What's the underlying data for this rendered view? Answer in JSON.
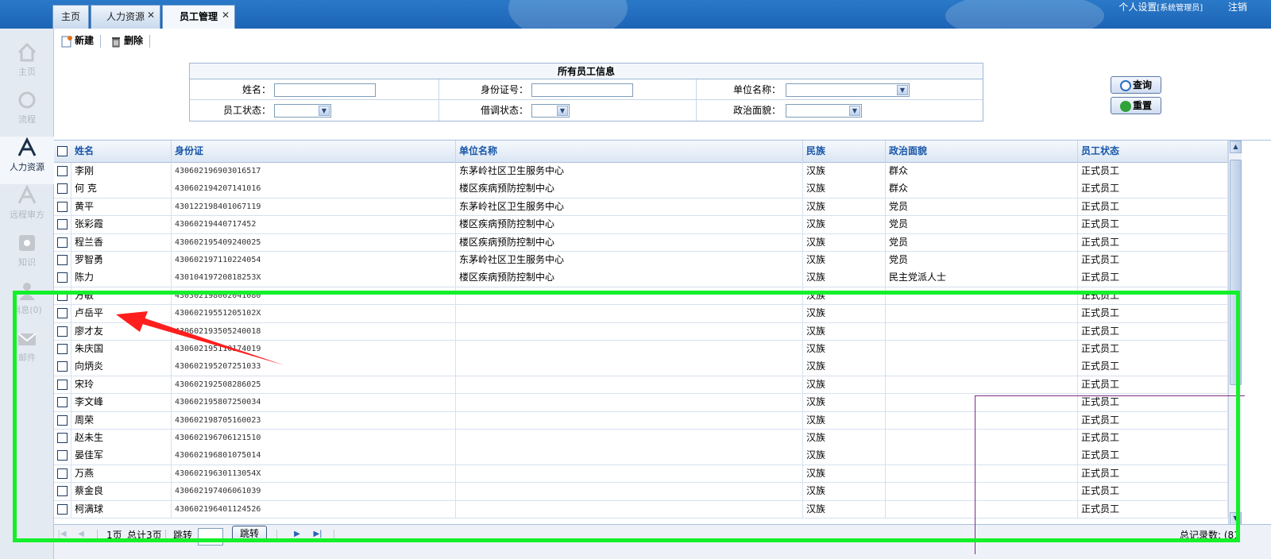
{
  "tabs": [
    {
      "label": "主页",
      "active": false,
      "closable": false
    },
    {
      "label": "人力资源",
      "active": false,
      "closable": true
    },
    {
      "label": "员工管理",
      "active": true,
      "closable": true
    }
  ],
  "topright": {
    "settings": "个人设置",
    "role": "[系统管理员]",
    "logout": "注销"
  },
  "sidebar": [
    {
      "label": "主页",
      "icon": "home-icon",
      "active": false
    },
    {
      "label": "流程",
      "icon": "refresh-icon",
      "active": false
    },
    {
      "label": "人力资源",
      "icon": "hr-icon",
      "active": true
    },
    {
      "label": "远程审方",
      "icon": "review-icon",
      "active": false
    },
    {
      "label": "知识",
      "icon": "knowledge-icon",
      "active": false
    },
    {
      "label": "消息(0)",
      "icon": "message-icon",
      "active": false
    },
    {
      "label": "邮件",
      "icon": "mail-icon",
      "active": false
    }
  ],
  "toolbar": {
    "new_label": "新建",
    "delete_label": "删除"
  },
  "search": {
    "title": "所有员工信息",
    "name_label": "姓名：",
    "id_label": "身份证号：",
    "unit_label": "单位名称：",
    "status_label": "员工状态：",
    "loan_label": "借调状态：",
    "politics_label": "政治面貌：",
    "query_label": "查询",
    "reset_label": "重置"
  },
  "table": {
    "headers": [
      "姓名",
      "身份证",
      "单位名称",
      "民族",
      "政治面貌",
      "员工状态"
    ],
    "rows": [
      [
        "李刚",
        "430602196903016517",
        "东茅岭社区卫生服务中心",
        "汉族",
        "群众",
        "正式员工"
      ],
      [
        "何 克",
        "430602194207141016",
        "楼区疾病预防控制中心",
        "汉族",
        "群众",
        "正式员工"
      ],
      [
        "黄平",
        "430122198401067119",
        "东茅岭社区卫生服务中心",
        "汉族",
        "党员",
        "正式员工"
      ],
      [
        "张彩霞",
        "43060219440717452",
        "楼区疾病预防控制中心",
        "汉族",
        "党员",
        "正式员工"
      ],
      [
        "程兰香",
        "430602195409240025",
        "楼区疾病预防控制中心",
        "汉族",
        "党员",
        "正式员工"
      ],
      [
        "罗智勇",
        "430602197110224054",
        "东茅岭社区卫生服务中心",
        "汉族",
        "党员",
        "正式员工"
      ],
      [
        "陈力",
        "43010419720818253X",
        "楼区疾病预防控制中心",
        "汉族",
        "民主党派人士",
        "正式员工"
      ],
      [
        "方敏",
        "430302198002041080",
        "",
        "汉族",
        "",
        "正式员工"
      ],
      [
        "卢岳平",
        "43060219551205102X",
        "",
        "汉族",
        "",
        "正式员工"
      ],
      [
        "廖才友",
        "430602193505240018",
        "",
        "汉族",
        "",
        "正式员工"
      ],
      [
        "朱庆国",
        "430602195110174019",
        "",
        "汉族",
        "",
        "正式员工"
      ],
      [
        "向炳炎",
        "430602195207251033",
        "",
        "汉族",
        "",
        "正式员工"
      ],
      [
        "宋玲",
        "430602192508286025",
        "",
        "汉族",
        "",
        "正式员工"
      ],
      [
        "李文峰",
        "430602195807250034",
        "",
        "汉族",
        "",
        "正式员工"
      ],
      [
        "周荣",
        "430602198705160023",
        "",
        "汉族",
        "",
        "正式员工"
      ],
      [
        "赵未生",
        "430602196706121510",
        "",
        "汉族",
        "",
        "正式员工"
      ],
      [
        "晏佳军",
        "430602196801075014",
        "",
        "汉族",
        "",
        "正式员工"
      ],
      [
        "万燕",
        "43060219630113054X",
        "",
        "汉族",
        "",
        "正式员工"
      ],
      [
        "蔡金良",
        "430602197406061039",
        "",
        "汉族",
        "",
        "正式员工"
      ],
      [
        "柯满球",
        "430602196401124526",
        "",
        "汉族",
        "",
        "正式员工"
      ]
    ]
  },
  "pager": {
    "page_text": "1页",
    "total_pages": "总计3页",
    "jump_label": "跳转",
    "jump_button": "跳转",
    "total_records": "总记录数: (81"
  },
  "colors": {
    "highlight": "#13f02a",
    "arrow": "#ff1e1e",
    "header_text": "#1856a8"
  }
}
